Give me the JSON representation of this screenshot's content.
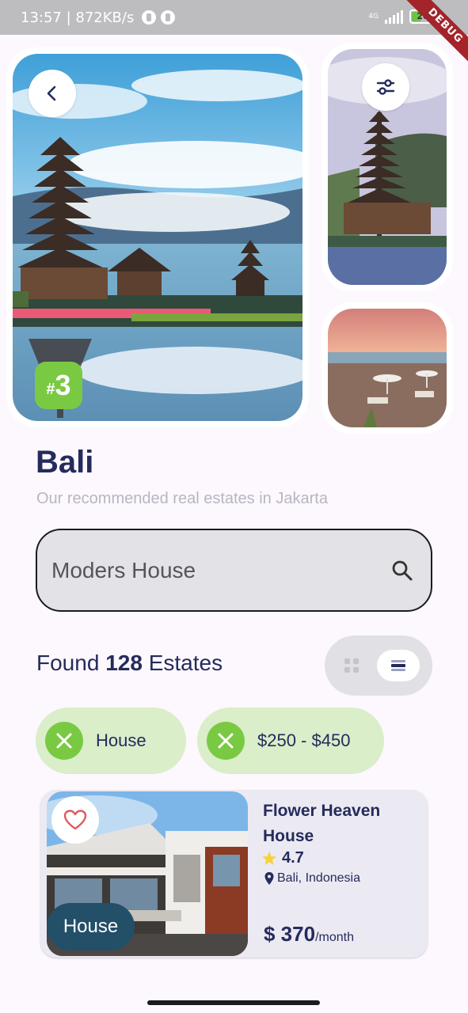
{
  "status_bar": {
    "left_text": "13:57 | 872KB/s",
    "network": "4G",
    "battery": "28",
    "debug_label": "DEBUG"
  },
  "gallery": {
    "rank_badge_hash": "#",
    "rank_badge_number": "3"
  },
  "header": {
    "title": "Bali",
    "subtitle": "Our recommended real estates in Jakarta"
  },
  "search": {
    "value": "Moders House"
  },
  "results": {
    "prefix": "Found",
    "count": "128",
    "suffix": "Estates"
  },
  "filters": [
    {
      "label": "House"
    },
    {
      "label": "$250 - $450"
    }
  ],
  "estate_card": {
    "title": "Flower Heaven House",
    "rating": "4.7",
    "location": "Bali, Indonesia",
    "price": "$ 370",
    "price_unit": "/month",
    "type_tag": "House"
  },
  "colors": {
    "accent_green": "#7ac943",
    "chip_green": "#d9eec9",
    "primary_text": "#252b5c",
    "tag_blue": "#234f68"
  }
}
